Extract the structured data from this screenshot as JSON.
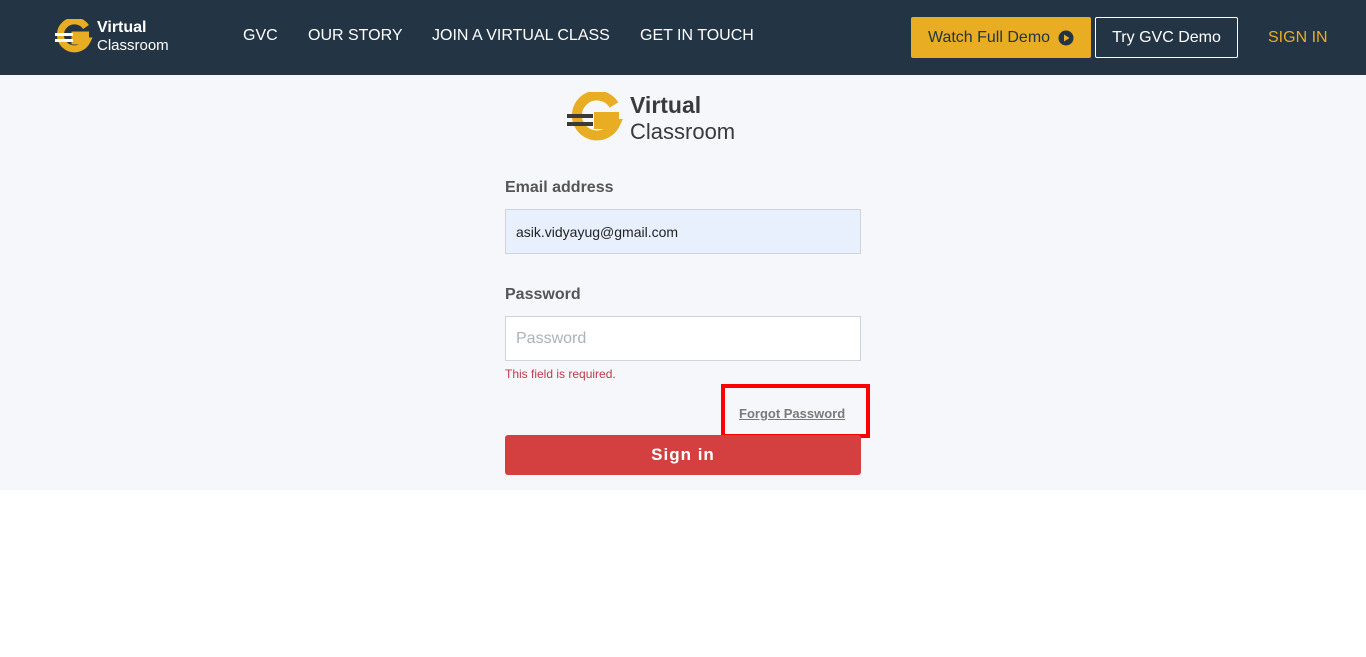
{
  "brand": {
    "line1": "Virtual",
    "line2": "Classroom",
    "accent_color": "#e8ad22",
    "header_color": "#233444"
  },
  "nav": {
    "items": [
      "GVC",
      "OUR STORY",
      "JOIN A VIRTUAL CLASS",
      "GET IN TOUCH"
    ],
    "watch_demo_label": "Watch Full Demo",
    "watch_demo_icon": "play-circle-icon",
    "try_demo_label": "Try GVC Demo",
    "sign_in_label": "SIGN IN"
  },
  "form": {
    "email_label": "Email address",
    "email_value": "asik.vidyayug@gmail.com",
    "password_label": "Password",
    "password_placeholder": "Password",
    "password_error": "This field is required.",
    "forgot_password_label": "Forgot Password",
    "submit_label": "Sign in",
    "submit_color": "#d43f3f"
  }
}
